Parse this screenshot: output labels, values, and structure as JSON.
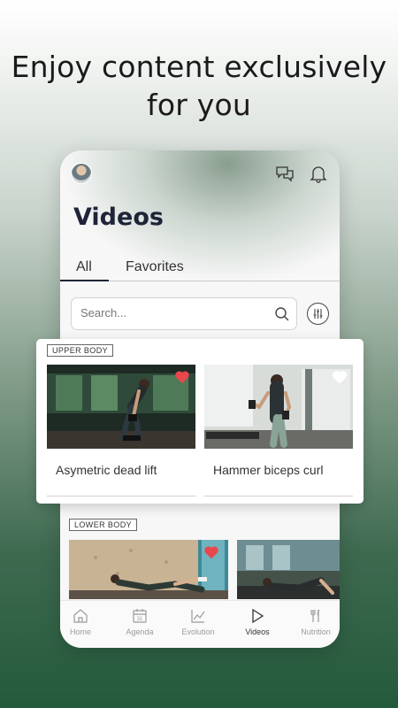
{
  "headline": {
    "line1": "Enjoy content exclusively",
    "line2": "for you"
  },
  "app": {
    "title": "Videos",
    "tabs": [
      {
        "label": "All",
        "active": true
      },
      {
        "label": "Favorites",
        "active": false
      }
    ],
    "search": {
      "placeholder": "Search..."
    },
    "icons": {
      "chat": "chat-icon",
      "notifications": "bell-icon",
      "filter": "sliders-icon",
      "search": "search-icon"
    }
  },
  "featured": {
    "category": "UPPER BODY",
    "videos": [
      {
        "title": "Asymetric dead lift",
        "favorite": true
      },
      {
        "title": "Hammer biceps curl",
        "favorite": false
      }
    ]
  },
  "lower_section": {
    "category": "LOWER BODY",
    "videos": [
      {
        "favorite": true
      },
      {
        "favorite": false
      }
    ]
  },
  "nav": [
    {
      "label": "Home",
      "icon": "home-icon",
      "active": false
    },
    {
      "label": "Agenda",
      "icon": "calendar-icon",
      "active": false
    },
    {
      "label": "Evolution",
      "icon": "chart-icon",
      "active": false
    },
    {
      "label": "Videos",
      "icon": "play-icon",
      "active": true
    },
    {
      "label": "Nutrition",
      "icon": "cutlery-icon",
      "active": false
    }
  ],
  "colors": {
    "accent": "#1f2438",
    "heart": "#e8474c",
    "brand_green": "#245a3c"
  }
}
